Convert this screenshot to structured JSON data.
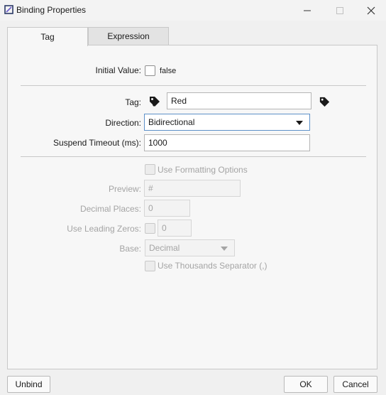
{
  "window": {
    "title": "Binding Properties",
    "icons": {
      "app": "app-icon",
      "minimize": "minimize-icon",
      "maximize": "maximize-icon",
      "close": "close-icon"
    }
  },
  "tabs": [
    {
      "label": "Tag",
      "active": true
    },
    {
      "label": "Expression",
      "active": false
    }
  ],
  "form": {
    "initial_value": {
      "label": "Initial Value:",
      "checked": false,
      "text": "false"
    },
    "tag": {
      "label": "Tag:",
      "value": "Red",
      "icons": [
        "tag-icon",
        "tag-browse-icon"
      ]
    },
    "direction": {
      "label": "Direction:",
      "selected": "Bidirectional"
    },
    "suspend_timeout": {
      "label": "Suspend Timeout (ms):",
      "value": "1000"
    }
  },
  "formatting": {
    "use_formatting": {
      "label": "Use Formatting Options",
      "checked": false
    },
    "preview": {
      "label": "Preview:",
      "value": "#"
    },
    "decimal_places": {
      "label": "Decimal Places:",
      "value": "0"
    },
    "leading_zeros": {
      "label": "Use Leading Zeros:",
      "checked": false,
      "value": "0"
    },
    "base": {
      "label": "Base:",
      "selected": "Decimal"
    },
    "thousands_separator": {
      "label": "Use Thousands Separator (,)",
      "checked": false
    }
  },
  "buttons": {
    "unbind": "Unbind",
    "ok": "OK",
    "cancel": "Cancel"
  },
  "colors": {
    "accent": "#5d91c9",
    "disabled_text": "#a4a4a4",
    "panel": "#f7f7f7"
  }
}
